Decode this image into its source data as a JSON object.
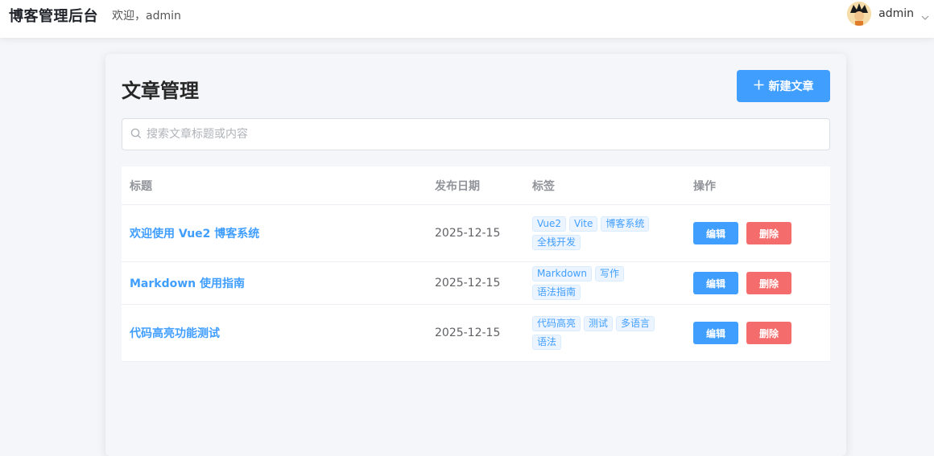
{
  "header": {
    "brand": "博客管理后台",
    "welcome": "欢迎，admin",
    "username": "admin"
  },
  "page": {
    "title": "文章管理",
    "new_button": "新建文章",
    "search_placeholder": "搜索文章标题或内容"
  },
  "table": {
    "columns": [
      "标题",
      "发布日期",
      "标签",
      "操作"
    ],
    "rows": [
      {
        "title": "欢迎使用 Vue2 博客系统",
        "date": "2025-12-15",
        "tags": [
          "Vue2",
          "Vite",
          "博客系统",
          "全栈开发"
        ],
        "edit": "编辑",
        "delete": "删除"
      },
      {
        "title": "Markdown 使用指南",
        "date": "2025-12-15",
        "tags": [
          "Markdown",
          "写作",
          "语法指南"
        ],
        "edit": "编辑",
        "delete": "删除"
      },
      {
        "title": "代码高亮功能测试",
        "date": "2025-12-15",
        "tags": [
          "代码高亮",
          "测试",
          "多语言",
          "语法"
        ],
        "edit": "编辑",
        "delete": "删除"
      }
    ]
  },
  "colors": {
    "primary": "#409eff",
    "danger": "#f56c6c",
    "background": "#f5f6fa"
  },
  "icons": {
    "search": "search-icon",
    "plus": "plus-icon",
    "chevron": "chevron-down-icon",
    "avatar": "avatar"
  }
}
